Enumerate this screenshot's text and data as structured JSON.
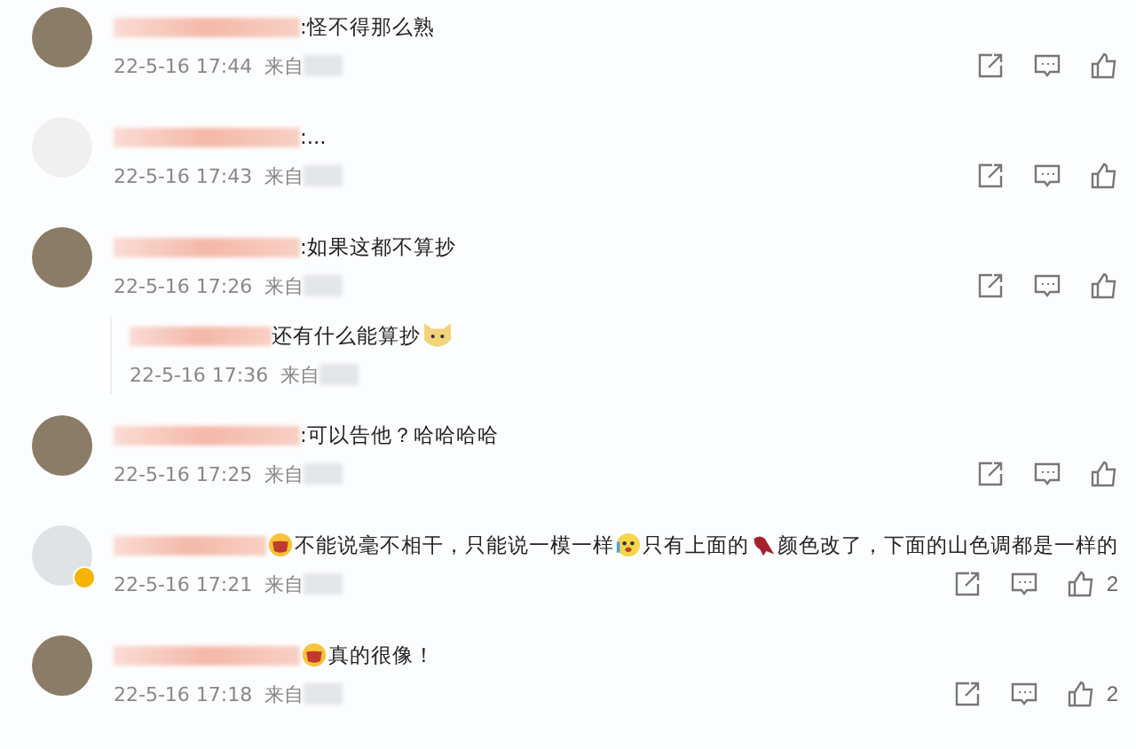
{
  "comments": [
    {
      "avatar": {
        "kind": "photo"
      },
      "verified": false,
      "parts": [
        {
          "kind": "text",
          "text": ":怪不得那么熟"
        }
      ],
      "time": "22-5-16 17:44",
      "source": "来自"
    },
    {
      "avatar": {
        "kind": "calligraphy"
      },
      "verified": false,
      "parts": [
        {
          "kind": "text",
          "text": ":..."
        }
      ],
      "time": "22-5-16 17:43",
      "source": "来自"
    },
    {
      "avatar": {
        "kind": "photo"
      },
      "verified": false,
      "parts": [
        {
          "kind": "text",
          "text": ":如果这都不算抄"
        }
      ],
      "time": "22-5-16 17:26",
      "source": "来自",
      "replies": [
        {
          "parts": [
            {
              "kind": "text",
              "text": "还有什么能算抄"
            },
            {
              "kind": "dog"
            }
          ],
          "time": "22-5-16 17:36",
          "source": "来自"
        }
      ]
    },
    {
      "avatar": {
        "kind": "photo"
      },
      "verified": false,
      "parts": [
        {
          "kind": "text",
          "text": ":可以告他？哈哈哈哈"
        }
      ],
      "time": "22-5-16 17:25",
      "source": "来自"
    },
    {
      "avatar": {
        "kind": "plain"
      },
      "verified": true,
      "parts": [
        {
          "kind": "grin"
        },
        {
          "kind": "text",
          "text": "不能说毫不相干，只能说一模一样"
        },
        {
          "kind": "cry"
        },
        {
          "kind": "text",
          "text": "只有上面的"
        },
        {
          "kind": "bird"
        },
        {
          "kind": "text",
          "text": " 颜色改了，下面的山色调都是一样的"
        }
      ],
      "time": "22-5-16 17:21",
      "source": "来自",
      "likes": "2"
    },
    {
      "avatar": {
        "kind": "photo"
      },
      "verified": false,
      "parts": [
        {
          "kind": "grin"
        },
        {
          "kind": "text",
          "text": "真的很像！"
        }
      ],
      "time": "22-5-16 17:18",
      "source": "来自",
      "likes": "2"
    }
  ]
}
